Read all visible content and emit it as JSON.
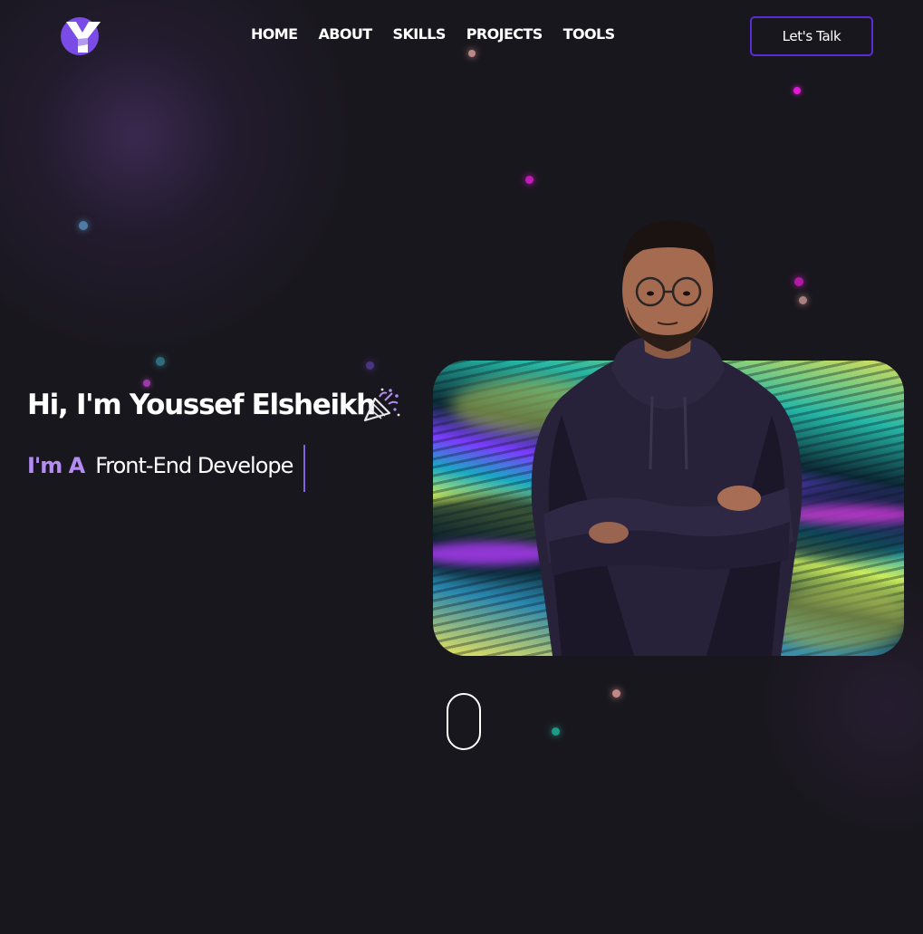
{
  "nav": {
    "links": [
      "HOME",
      "ABOUT",
      "SKILLS",
      "PROJECTS",
      "TOOLS"
    ],
    "cta_label": "Let's Talk",
    "logo_icon": "y-logo-icon"
  },
  "hero": {
    "greeting": "Hi, I'm Youssef Elsheikh",
    "greeting_icon": "party-popper-icon",
    "role_prefix": "I'm A",
    "role_text": "Front-End Develope",
    "photo_alt": "Youssef Elsheikh portrait"
  },
  "scroll": {
    "icon": "scroll-mouse-icon"
  },
  "colors": {
    "background": "#19171e",
    "accent_purple": "#b48cf2",
    "button_border": "#5b2bd6",
    "logo_purple": "#7b4be8"
  }
}
